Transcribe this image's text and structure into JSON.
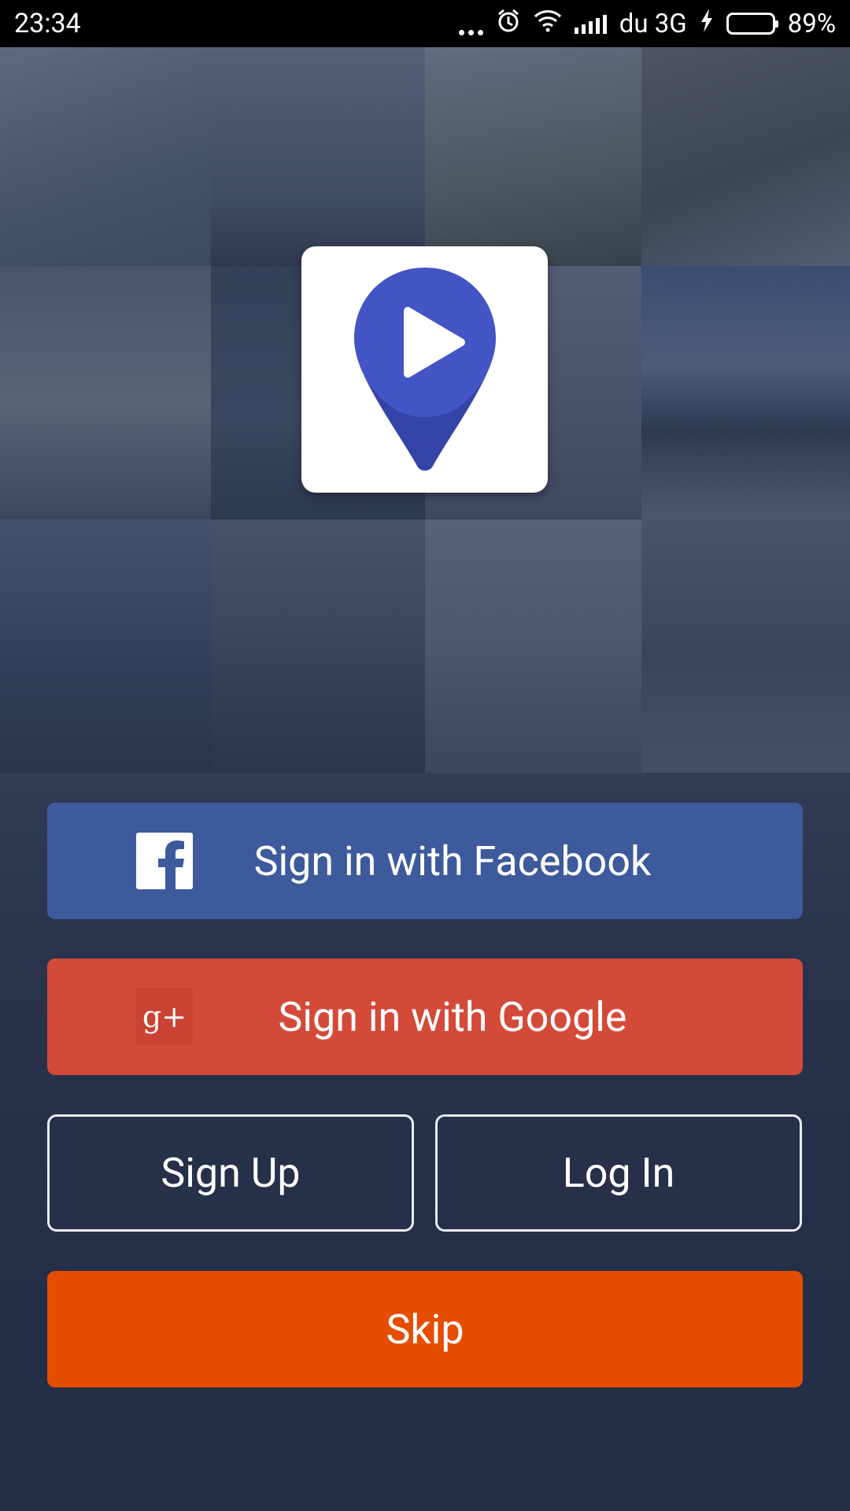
{
  "status_bar": {
    "time": "23:34",
    "network": "du 3G",
    "battery": "89%",
    "battery_level": 0.89,
    "icons": [
      "more-dots-icon",
      "alarm-icon",
      "wifi-icon",
      "signal-icon",
      "charging-icon",
      "battery-icon"
    ]
  },
  "logo": {
    "icon": "location-play-pin-icon",
    "colors": {
      "pin": "#4355c4",
      "pin_shadow": "#3444a6",
      "card": "#ffffff"
    }
  },
  "buttons": {
    "facebook": {
      "label": "Sign in with Facebook",
      "icon": "facebook-icon",
      "color": "#3d5a9c"
    },
    "google": {
      "label": "Sign in with Google",
      "icon": "google-plus-icon",
      "color": "#d44a39"
    },
    "signup": {
      "label": "Sign Up"
    },
    "login": {
      "label": "Log In"
    },
    "skip": {
      "label": "Skip",
      "color": "#e54d00"
    }
  }
}
